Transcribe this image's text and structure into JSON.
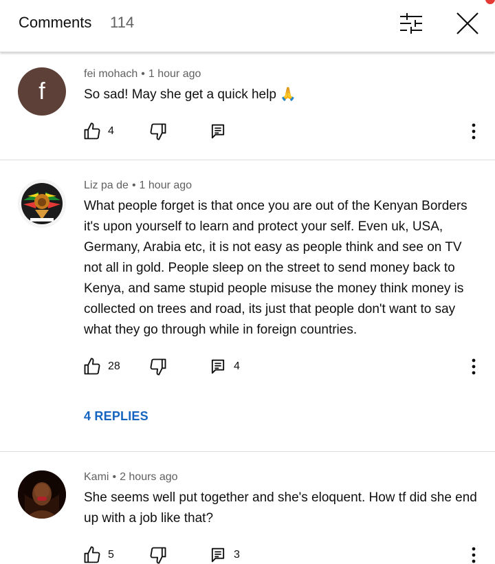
{
  "header": {
    "title": "Comments",
    "count": "114"
  },
  "comments": [
    {
      "author": "fei mohach",
      "separator": "•",
      "time": "1 hour ago",
      "avatar_letter": "f",
      "avatar_color": "#5d4037",
      "text": "So sad! May she get a quick help 🙏",
      "likes": "4",
      "replies_count": ""
    },
    {
      "author": "Liz pa de",
      "separator": "•",
      "time": "1 hour ago",
      "text": "What people forget is that once you are out of the Kenyan Borders it's upon yourself to learn and protect your self. Even uk, USA, Germany, Arabia etc, it is not easy as people think and see on TV not all in gold. People sleep on the street to send money back to Kenya, and same stupid people misuse the money think money is collected on trees and road, its just that people don't want to say what they go through while in foreign countries.",
      "likes": "28",
      "replies_count": "4",
      "replies_link": "4 REPLIES"
    },
    {
      "author": "Kami",
      "separator": "•",
      "time": "2 hours ago",
      "text": "She seems well put together and she's eloquent. How tf did she end up with a job like that?",
      "likes": "5",
      "replies_count": "3"
    }
  ],
  "icons": {
    "filter": "filter-sliders-icon",
    "close": "close-icon",
    "like": "thumbs-up-icon",
    "dislike": "thumbs-down-icon",
    "reply": "reply-comment-icon",
    "more": "more-vertical-icon"
  },
  "colors": {
    "link": "#1565c0",
    "secondary_text": "#606060",
    "notification_dot": "#e53935"
  }
}
